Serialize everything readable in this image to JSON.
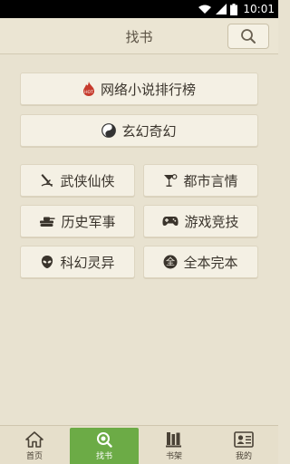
{
  "status_bar": {
    "time": "10:01"
  },
  "header": {
    "title": "找书",
    "search_icon": "search-icon"
  },
  "featured": [
    {
      "label": "网络小说排行榜",
      "icon": "fire-icon"
    },
    {
      "label": "玄幻奇幻",
      "icon": "yin-yang-icon"
    }
  ],
  "categories": [
    {
      "label": "武侠仙侠",
      "icon": "sword-icon"
    },
    {
      "label": "都市言情",
      "icon": "cocktail-icon"
    },
    {
      "label": "历史军事",
      "icon": "tank-icon"
    },
    {
      "label": "游戏竞技",
      "icon": "gamepad-icon"
    },
    {
      "label": "科幻灵异",
      "icon": "alien-icon"
    },
    {
      "label": "全本完本",
      "icon": "complete-icon"
    }
  ],
  "tabs": [
    {
      "label": "首页",
      "icon": "home-icon",
      "active": false
    },
    {
      "label": "找书",
      "icon": "search-icon",
      "active": true
    },
    {
      "label": "书架",
      "icon": "bookshelf-icon",
      "active": false
    },
    {
      "label": "我的",
      "icon": "profile-card-icon",
      "active": false
    }
  ],
  "colors": {
    "background": "#e8e2d0",
    "button": "#f4f0e4",
    "active_tab": "#6cab46",
    "text": "#3a342c"
  }
}
